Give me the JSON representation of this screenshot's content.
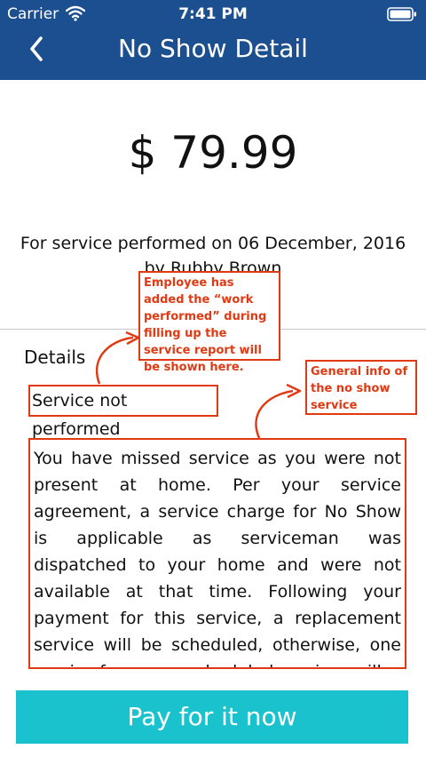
{
  "status_bar": {
    "carrier": "Carrier",
    "time": "7:41 PM",
    "wifi_icon": "wifi-icon",
    "battery_icon": "battery-icon"
  },
  "nav": {
    "back_icon": "chevron-left-icon",
    "title": "No Show Detail"
  },
  "amount": "$ 79.99",
  "service": {
    "performed_on": "For service performed on 06 December, 2016",
    "performed_by": "by Rubby Brown"
  },
  "details": {
    "heading": "Details",
    "work_performed": "Service not performed",
    "info_text": "You have missed service as you were not present at home. Per your service agreement, a service charge for No Show is applicable as serviceman was dispatched to your home and were not available at that time. Following your payment for this service, a replacement service will be scheduled, otherwise, one service from your scheduled services will"
  },
  "annotations": {
    "work_note": "Employee has added the “work performed” during filling up the service report will be shown here.",
    "info_note": "General info of the no show service"
  },
  "pay_button": {
    "label": "Pay for it now"
  },
  "colors": {
    "nav_bar": "#1b4f8f",
    "pay_button": "#19c2cc",
    "annotation": "#e03a14"
  }
}
